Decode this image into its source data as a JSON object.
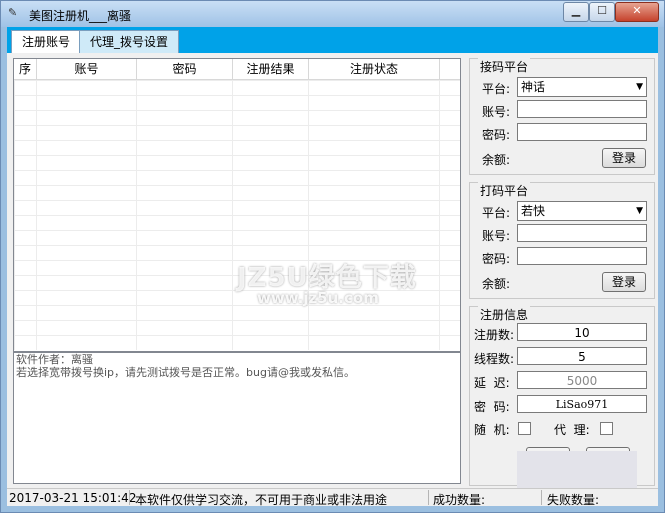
{
  "window": {
    "title": "美图注册机___离骚"
  },
  "tabs": [
    {
      "label": "注册账号"
    },
    {
      "label": "代理_拨号设置"
    }
  ],
  "grid": {
    "columns": [
      "序",
      "账号",
      "密码",
      "注册结果",
      "注册状态"
    ]
  },
  "log": {
    "lines": [
      "软件作者：离骚",
      "若选择宽带拨号换ip，请先测试拨号是否正常。bug请@我或发私信。"
    ]
  },
  "receive_platform": {
    "title": "接码平台",
    "platform_label": "平台:",
    "platform_value": "神话",
    "account_label": "账号:",
    "password_label": "密码:",
    "balance_label": "余额:",
    "login_button": "登录"
  },
  "captcha_platform": {
    "title": "打码平台",
    "platform_label": "平台:",
    "platform_value": "若快",
    "account_label": "账号:",
    "password_label": "密码:",
    "balance_label": "余额:",
    "login_button": "登录"
  },
  "register_info": {
    "title": "注册信息",
    "count_label": "注册数:",
    "count_value": "10",
    "threads_label": "线程数:",
    "threads_value": "5",
    "delay_label": "延  迟:",
    "delay_value": "5000",
    "password_label": "密  码:",
    "password_value": "LiSao971",
    "random_label": "随  机:",
    "proxy_label": "代  理:"
  },
  "statusbar": {
    "datetime": "2017-03-21 15:01:42",
    "notice": "本软件仅供学习交流，不可用于商业或非法用途",
    "success_label": "成功数量:",
    "fail_label": "失败数量:"
  },
  "watermark": {
    "line1": "JZ5U绿色下载",
    "line2": "www.jz5u.com"
  }
}
